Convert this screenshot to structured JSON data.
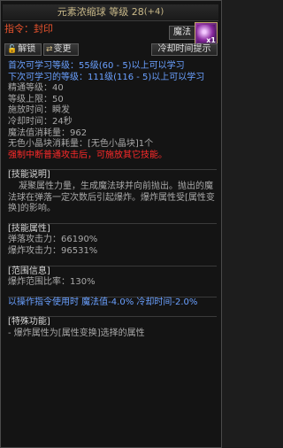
{
  "title": {
    "name": "元素浓缩球",
    "level_label": "等级",
    "level": "28",
    "bonus": "(+4)"
  },
  "command": {
    "label": "指令：",
    "value": "封印"
  },
  "type_badge": "魔法",
  "icon": {
    "name": "element-orb-icon",
    "sub_label": "x1"
  },
  "buttons": {
    "unlock": "解锁",
    "change": "变更",
    "cooldown_hint": "冷却时间提示"
  },
  "lines": {
    "first_learn": "首次可学习等级：55级(60 - 5)以上可以学习",
    "next_learn": "下次可学习的等级：111级(116 - 5)以上可以学习",
    "mastery": "精通等级：40",
    "max_level": "等级上限：50",
    "cast_time": "施放时间：瞬发",
    "cooldown": "冷却时间：24秒",
    "mp_cost": "魔法值消耗量：962",
    "no_crystal": "无色小晶块消耗量：[无色小晶块]1个",
    "force_interrupt": "强制中断普通攻击后，可施放其它技能。",
    "desc_header": "[技能说明]",
    "desc_text": "凝聚属性力量，生成魔法球并向前抛出。抛出的魔法球在弹落一定次数后引起爆炸。爆炸属性受[属性变换]的影响。",
    "attr_header": "[技能属性]",
    "bounce_atk": "弹落攻击力：66190%",
    "explode_atk": "爆炸攻击力：96531%",
    "range_header": "[范围信息]",
    "explode_range": "爆炸范围比率：130%",
    "cmd_bonus": "以操作指令使用时 魔法值-4.0% 冷却时间-2.0%",
    "special_header": "[特殊功能]",
    "special_text": "- 爆炸属性为[属性变换]选择的属性"
  },
  "colors": {
    "blue": "#6aa0ff",
    "green": "#56d24a",
    "red": "#ff2a2a",
    "gray": "#a9a9a9",
    "command_red": "#e8532e",
    "title_gold": "#c9b989"
  }
}
